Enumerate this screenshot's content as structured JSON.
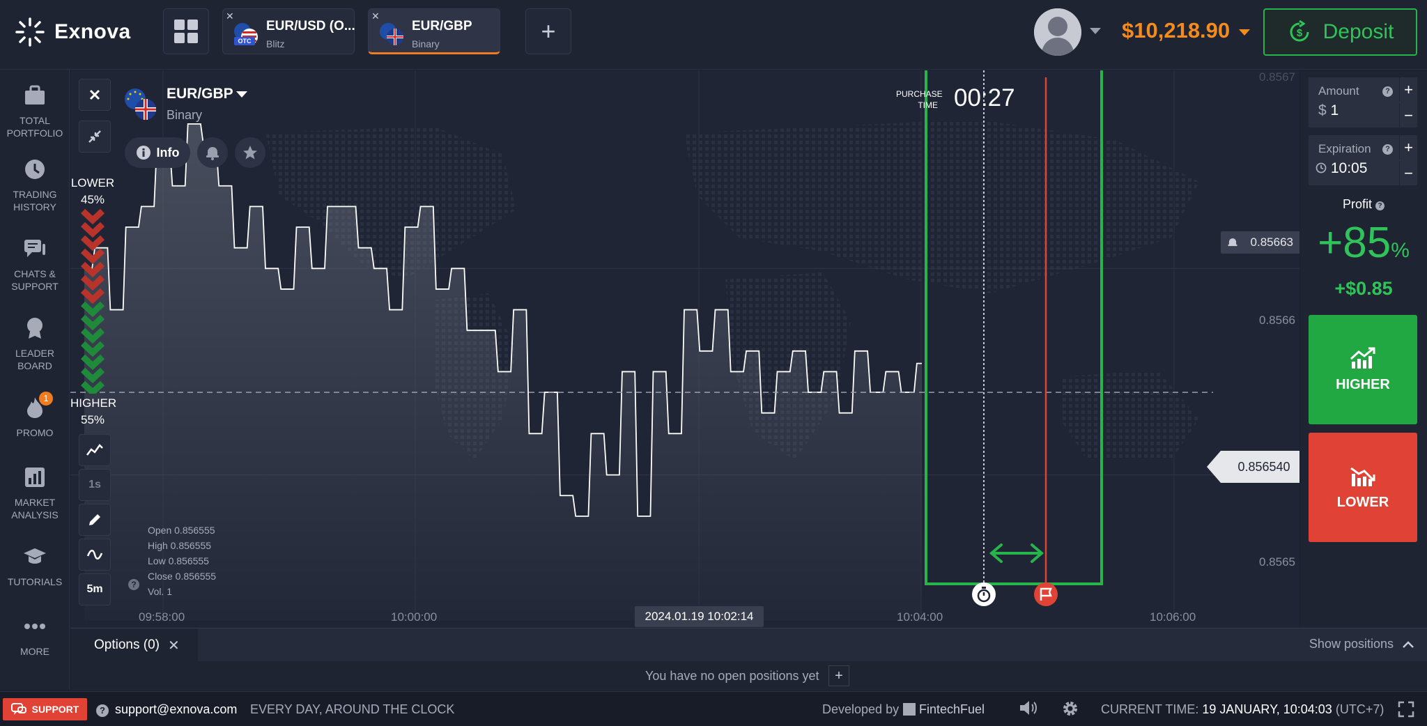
{
  "brand": {
    "name": "Exnova"
  },
  "tabs": [
    {
      "name": "EUR/USD (O...",
      "type": "Blitz",
      "badge": "OTC",
      "active": false
    },
    {
      "name": "EUR/GBP",
      "type": "Binary",
      "active": true
    }
  ],
  "account": {
    "balance": "$10,218.90",
    "deposit_label": "Deposit"
  },
  "sidebar": {
    "items": [
      {
        "label": "TOTAL PORTFOLIO",
        "icon": "briefcase-icon"
      },
      {
        "label": "TRADING HISTORY",
        "icon": "clock-icon"
      },
      {
        "label": "CHATS & SUPPORT",
        "icon": "chat-icon"
      },
      {
        "label": "LEADER BOARD",
        "icon": "award-icon"
      },
      {
        "label": "PROMO",
        "icon": "fire-icon",
        "badge": "1"
      },
      {
        "label": "MARKET ANALYSIS",
        "icon": "bar-chart-icon"
      },
      {
        "label": "TUTORIALS",
        "icon": "graduation-cap-icon"
      },
      {
        "label": "MORE",
        "icon": "more-icon"
      }
    ]
  },
  "asset": {
    "name": "EUR/GBP",
    "type": "Binary",
    "info_label": "Info"
  },
  "sentiment": {
    "lower_label": "LOWER",
    "lower_pct": "45%",
    "higher_label": "HIGHER",
    "higher_pct": "55%"
  },
  "chart_tools": {
    "interval": "1s",
    "timeframe": "5m"
  },
  "ohlc": {
    "open": "Open  0.856555",
    "high": "High  0.856555",
    "low": "Low   0.856555",
    "close": "Close  0.856555",
    "vol": "Vol.  1"
  },
  "purchase": {
    "label": "PURCHASE TIME",
    "timer": "00:27"
  },
  "price": {
    "current": "0.856540",
    "alert": "0.85663"
  },
  "chart_data": {
    "type": "line",
    "y_ticks": [
      "0.8567",
      "0.8566",
      "0.8565"
    ],
    "x_ticks": [
      "09:58:00",
      "10:00:00",
      "10:04:00",
      "10:06:00"
    ],
    "cursor_time": "2024.01.19 10:02:14",
    "ylim": [
      0.85643,
      0.8567
    ],
    "series": [
      {
        "values": [
          0.8566,
          0.85661,
          0.85658,
          0.85662,
          0.85663,
          0.85666,
          0.85664,
          0.85667,
          0.85666,
          0.85664,
          0.85661,
          0.85663,
          0.8566,
          0.85659,
          0.85662,
          0.8566,
          0.85663,
          0.85663,
          0.85661,
          0.8566,
          0.85658,
          0.85662,
          0.85663,
          0.85659,
          0.8566,
          0.85657,
          0.85657,
          0.85655,
          0.85658,
          0.85652,
          0.85654,
          0.85649,
          0.85648,
          0.85652,
          0.8565,
          0.85655,
          0.85648,
          0.85655,
          0.85652,
          0.85658,
          0.85656,
          0.85658,
          0.85655,
          0.85656,
          0.85653,
          0.85655,
          0.85656,
          0.85654,
          0.85655,
          0.85653,
          0.85656,
          0.85654,
          0.85655,
          0.85654,
          0.856554
        ]
      }
    ]
  },
  "trade": {
    "amount_label": "Amount",
    "amount_currency": "$",
    "amount_value": "1",
    "expiration_label": "Expiration",
    "expiration_value": "10:05",
    "profit_label": "Profit",
    "profit_pct": "+85",
    "profit_pct_unit": "%",
    "profit_amount": "+$0.85",
    "higher_label": "HIGHER",
    "lower_label": "LOWER"
  },
  "positions": {
    "tab_label": "Options (0)",
    "show_label": "Show positions",
    "empty_message": "You have no open positions yet"
  },
  "footer": {
    "support_label": "SUPPORT",
    "email": "support@exnova.com",
    "hours": "EVERY DAY, AROUND THE CLOCK",
    "developed_by": "Developed by",
    "developer": "FintechFuel",
    "current_time_label": "CURRENT TIME:",
    "current_time_value": "19 JANUARY, 10:04:03",
    "timezone": "(UTC+7)"
  },
  "colors": {
    "accent": "#f48b1e",
    "up": "#21a842",
    "down": "#e04335",
    "background": "#202536"
  }
}
